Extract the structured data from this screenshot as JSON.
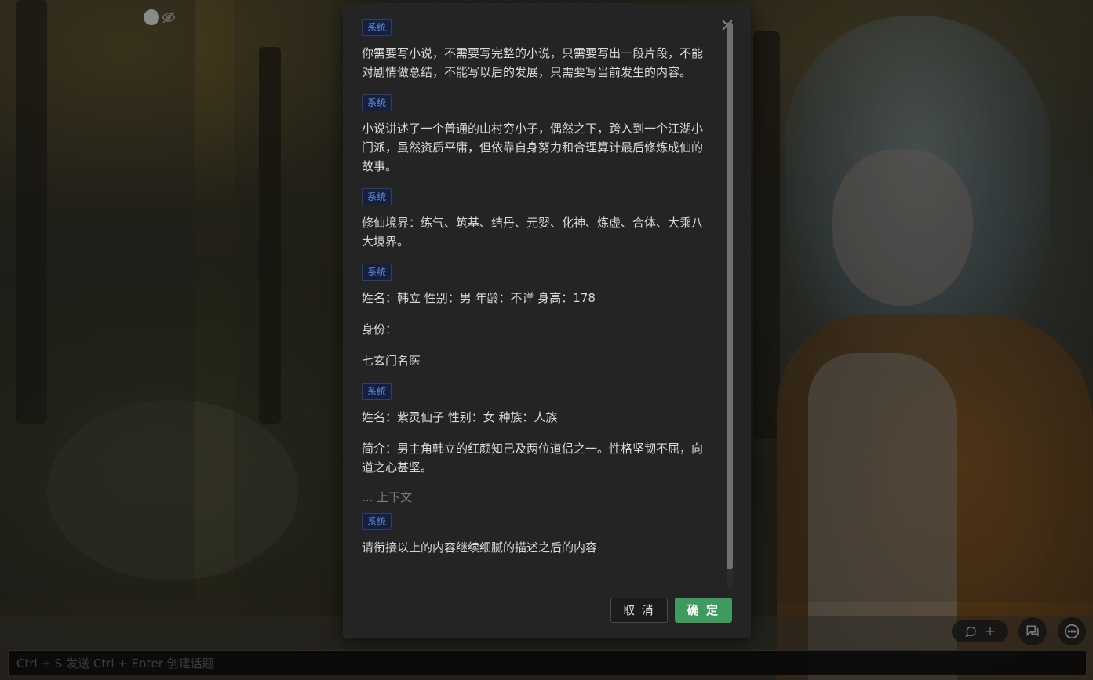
{
  "app": {
    "composer_hint": "Ctrl + S 发送    Ctrl + Enter 创建话题"
  },
  "modal": {
    "messages": [
      {
        "role": "系统",
        "paragraphs": [
          "你需要写小说，不需要写完整的小说，只需要写出一段片段，不能",
          "对剧情做总结，不能写以后的发展，只需要写当前发生的内容。"
        ]
      },
      {
        "role": "系统",
        "paragraphs": [
          "小说讲述了一个普通的山村穷小子，偶然之下，跨入到一个江湖小",
          "门派，虽然资质平庸，但依靠自身努力和合理算计最后修炼成仙的",
          "故事。"
        ]
      },
      {
        "role": "系统",
        "paragraphs": [
          "修仙境界：练气、筑基、结丹、元婴、化神、炼虚、合体、大乘八",
          "大境界。"
        ]
      },
      {
        "role": "系统",
        "paragraphs": [
          "姓名：韩立 性别：男 年龄：不详 身高：178",
          "身份：",
          "七玄门名医"
        ]
      },
      {
        "role": "系统",
        "paragraphs": [
          "姓名：紫灵仙子 性别：女 种族：人族",
          "简介：男主角韩立的红颜知己及两位道侣之一。性格坚韧不屈，向",
          "道之心甚坚。"
        ]
      }
    ],
    "context_divider": "... 上下文",
    "final_message": {
      "role": "系统",
      "text": "请衔接以上的内容继续细腻的描述之后的内容"
    },
    "cancel_label": "取 消",
    "confirm_label": "确 定"
  },
  "colors": {
    "badge_text": "#5f8be0",
    "badge_bg": "#17203a",
    "confirm": "#3e9a5e"
  }
}
